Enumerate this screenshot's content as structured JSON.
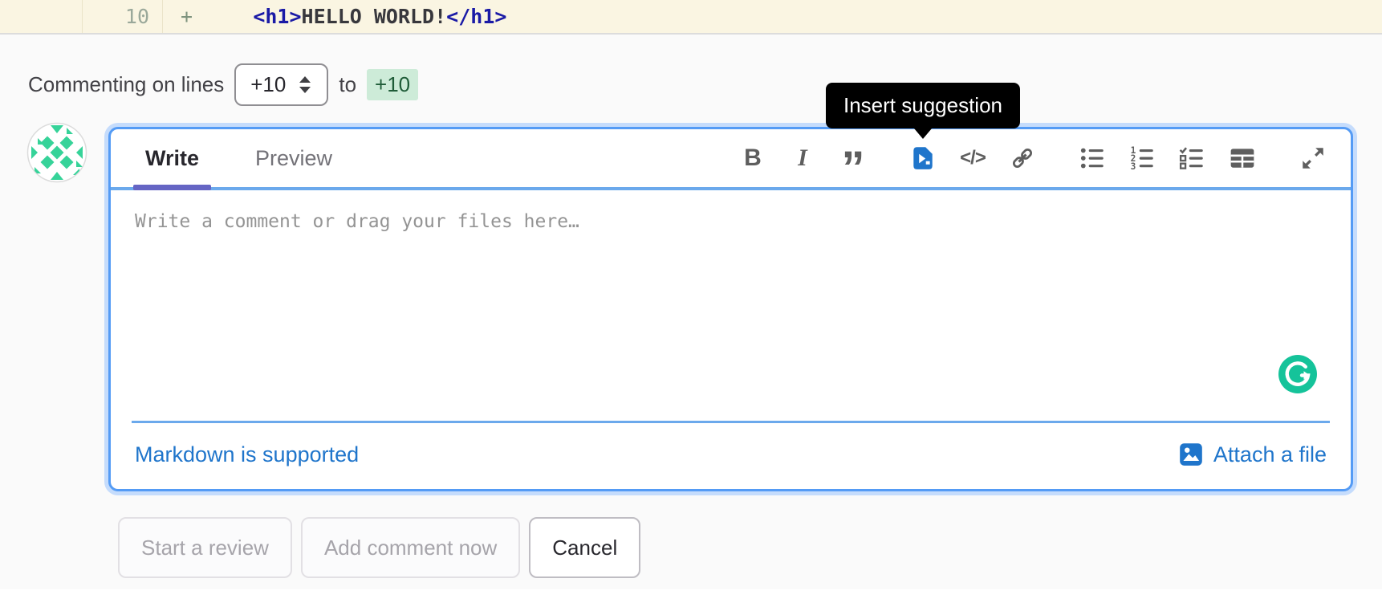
{
  "diff_line": {
    "new_number": "10",
    "marker": "+",
    "indent": "     ",
    "tag_open": "<h1>",
    "content": "HELLO WORLD!",
    "tag_close": "</h1>"
  },
  "comment_header": {
    "label": "Commenting on lines",
    "selected_line": "+10",
    "to": "to",
    "end_line": "+10"
  },
  "editor": {
    "tabs": [
      {
        "label": "Write"
      },
      {
        "label": "Preview"
      }
    ],
    "active_tab": "Write",
    "tooltip": "Insert suggestion",
    "toolbar_glyphs": {
      "bold": "B",
      "italic": "I",
      "quote": "”",
      "code": "</>"
    },
    "toolbar_icons": [
      "bold",
      "italic",
      "quote",
      "insert-suggestion",
      "code",
      "link",
      "bulleted-list",
      "numbered-list",
      "task-list",
      "table",
      "fullscreen"
    ],
    "placeholder": "Write a comment or drag your files here…",
    "markdown_note": "Markdown is supported",
    "attach_label": "Attach a file"
  },
  "actions": {
    "start_review": "Start a review",
    "add_comment": "Add comment now",
    "cancel": "Cancel"
  },
  "colors": {
    "accent_blue": "#1f75cb",
    "focus_border": "#549bf5",
    "focus_ring": "#c5dcfc",
    "divider_blue": "#6ba9ec",
    "active_tab_underline": "#6565c4",
    "added_line_bg": "#faf5e2",
    "added_chip_bg": "#cdebd8",
    "added_chip_text": "#1f5c38",
    "tooltip_bg": "#000000",
    "grammarly_green": "#15c39a",
    "avatar_green": "#36d399"
  }
}
